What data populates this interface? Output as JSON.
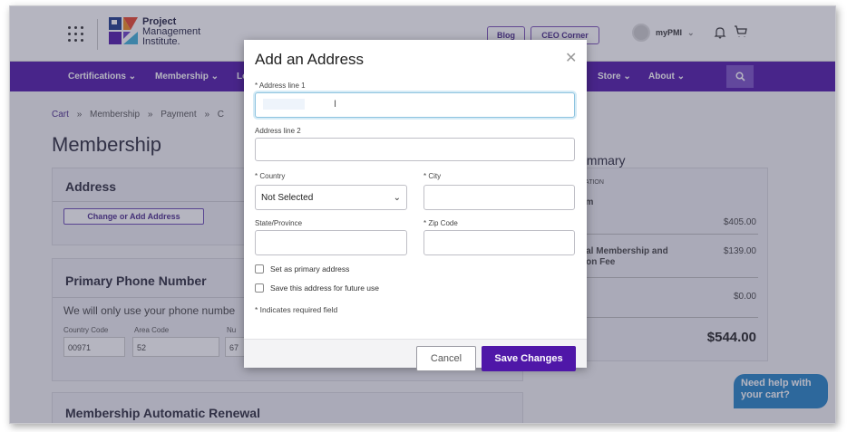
{
  "header": {
    "logo_line1": "Project",
    "logo_line2": "Management",
    "logo_line3": "Institute.",
    "blog_label": "Blog",
    "ceo_label": "CEO Corner",
    "mypmi_label": "myPMI",
    "bell_icon": "bell-icon",
    "cart_icon": "cart-icon"
  },
  "nav": {
    "items": [
      "Certifications ⌄",
      "Membership ⌄",
      "Le",
      "Store ⌄",
      "About ⌄"
    ],
    "search_icon": "search-icon"
  },
  "breadcrumb": {
    "cart": "Cart",
    "sep": "»",
    "membership": "Membership",
    "payment": "Payment",
    "next": "C"
  },
  "page": {
    "title": "Membership",
    "address_heading": "Address",
    "change_address_label": "Change or Add Address",
    "phone_heading": "Primary Phone Number",
    "phone_note": "We will only use your phone numbe",
    "country_code_label": "Country Code",
    "area_code_label": "Area Code",
    "number_label": "Nu",
    "country_code_value": "00971",
    "area_code_value": "52",
    "number_value": "67",
    "renewal_heading": "Membership Automatic Renewal"
  },
  "summary": {
    "title": "ummary",
    "section_label": "CATION",
    "item1_label": "am",
    "item1_value": "$405.00",
    "item2_label_line1": "ual Membership and",
    "item2_label_line2": "tion Fee",
    "item2_value": "$139.00",
    "item3_value": "$0.00",
    "total_value": "$544.00"
  },
  "help": {
    "line1": "Need help with",
    "line2": "your cart?"
  },
  "modal": {
    "title": "Add an Address",
    "address1_label": "* Address line 1",
    "address2_label": "Address line 2",
    "country_label": "* Country",
    "country_value": "Not Selected",
    "city_label": "* City",
    "state_label": "State/Province",
    "zip_label": "* Zip Code",
    "primary_checkbox_label": "Set as primary address",
    "future_checkbox_label": "Save this address for future use",
    "required_note": "* Indicates required field",
    "cancel_label": "Cancel",
    "save_label": "Save Changes"
  },
  "colors": {
    "brand_purple": "#4f17a8",
    "help_blue": "#2483c6"
  }
}
